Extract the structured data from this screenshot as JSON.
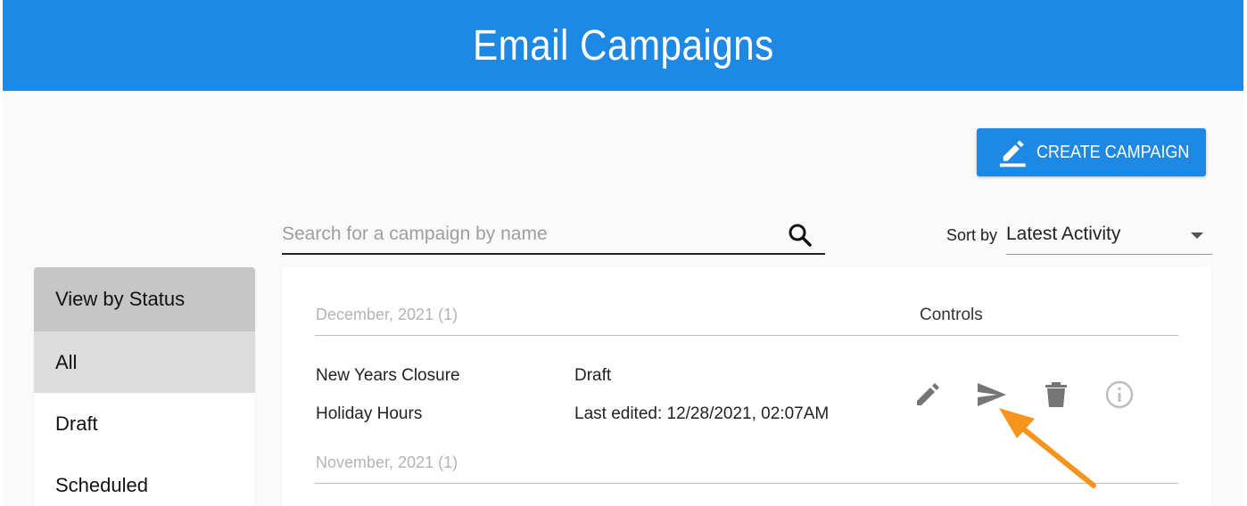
{
  "header": {
    "title": "Email Campaigns"
  },
  "toolbar": {
    "create_label": "CREATE CAMPAIGN"
  },
  "search": {
    "placeholder": "Search for a campaign by name",
    "value": ""
  },
  "sort": {
    "label": "Sort by",
    "selected": "Latest Activity"
  },
  "sidebar": {
    "title": "View by Status",
    "items": [
      {
        "label": "All",
        "active": true
      },
      {
        "label": "Draft",
        "active": false
      },
      {
        "label": "Scheduled",
        "active": false
      }
    ]
  },
  "campaigns": {
    "controls_title": "Controls",
    "groups": [
      {
        "title": "December, 2021 (1)",
        "rows": [
          {
            "name": "New Years Closure",
            "subject": "Holiday Hours",
            "status": "Draft",
            "edited": "Last edited: 12/28/2021, 02:07AM",
            "controls": [
              "pencil-icon",
              "send-icon",
              "trash-icon",
              "info-icon"
            ]
          }
        ]
      },
      {
        "title": "November, 2021 (1)",
        "rows": []
      }
    ]
  },
  "annotation": {
    "color": "#f7941d",
    "points_to": "send-icon"
  },
  "colors": {
    "brand": "#1e88e5",
    "icon": "#757575",
    "info_icon": "#bdbdbd"
  }
}
